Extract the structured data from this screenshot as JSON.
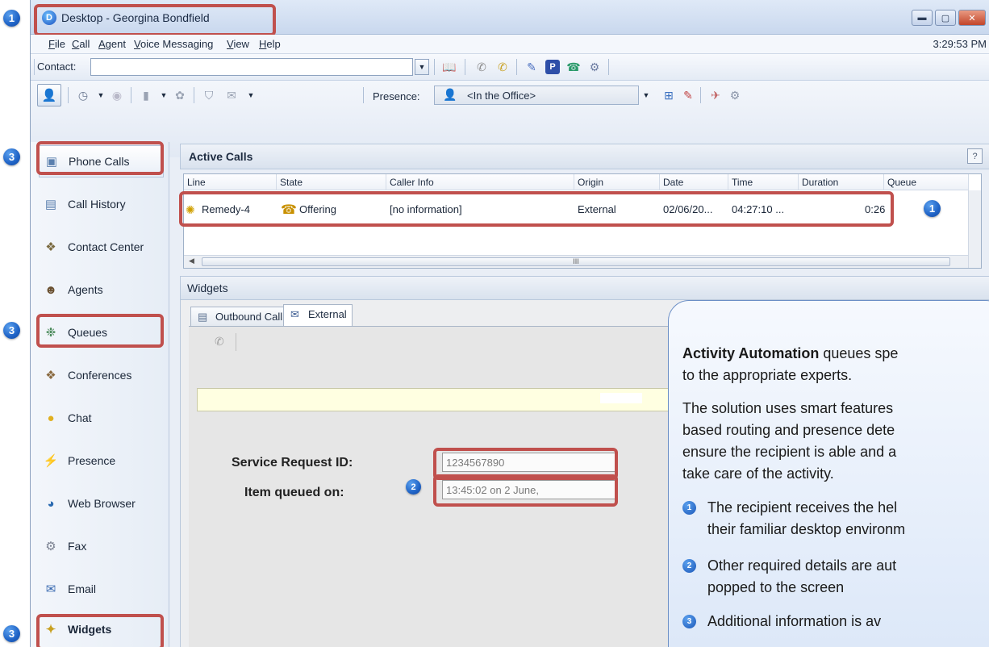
{
  "window": {
    "title": "Desktop - Georgina Bondfield",
    "app_logo": "D",
    "clock": "3:29:53 PM"
  },
  "menu": [
    "File",
    "Call",
    "Agent",
    "Voice Messaging",
    "View",
    "Help"
  ],
  "contact": {
    "label": "Contact:",
    "value": ""
  },
  "presence": {
    "label": "Presence:",
    "value": "<In the Office>"
  },
  "markers": {
    "title": "1",
    "active_call": "1",
    "fields": "2",
    "phone_calls": "3",
    "queues": "3",
    "widgets": "3"
  },
  "sidebar": {
    "items": [
      {
        "label": "Phone Calls",
        "icon": "phone-calls-icon"
      },
      {
        "label": "Call History",
        "icon": "call-history-icon"
      },
      {
        "label": "Contact Center",
        "icon": "contact-center-icon"
      },
      {
        "label": "Agents",
        "icon": "agents-icon"
      },
      {
        "label": "Queues",
        "icon": "queues-icon"
      },
      {
        "label": "Conferences",
        "icon": "conferences-icon"
      },
      {
        "label": "Chat",
        "icon": "chat-icon"
      },
      {
        "label": "Presence",
        "icon": "presence-icon"
      },
      {
        "label": "Web Browser",
        "icon": "web-browser-icon"
      },
      {
        "label": "Fax",
        "icon": "fax-icon"
      },
      {
        "label": "Email",
        "icon": "email-icon"
      },
      {
        "label": "Widgets",
        "icon": "widgets-icon"
      }
    ]
  },
  "active_calls": {
    "title": "Active Calls",
    "help": "?",
    "columns": [
      "Line",
      "State",
      "Caller Info",
      "Origin",
      "Date",
      "Time",
      "Duration",
      "Queue"
    ],
    "rows": [
      {
        "line": "Remedy-4",
        "state": "Offering",
        "caller_info": "[no information]",
        "origin": "External",
        "date": "02/06/20...",
        "time": "04:27:10 ...",
        "duration": "0:26",
        "queue": ""
      }
    ],
    "scroll_marker": "III"
  },
  "widgets": {
    "title": "Widgets",
    "tabs": [
      "Outbound Call",
      "External"
    ],
    "active_tab": "External",
    "form": {
      "service_request_label": "Service Request ID:",
      "service_request_value": "1234567890",
      "queued_on_label": "Item queued on:",
      "queued_on_value": "13:45:02 on 2 June,"
    }
  },
  "callout": {
    "line1_bold": "Activity Automation",
    "line1_rest": " queues spe",
    "line2": "to the appropriate experts.",
    "line3": "The solution uses smart features",
    "line4": "based routing and presence dete",
    "line5": "ensure the recipient is able and a",
    "line6": "take care of the activity.",
    "bullet1_num": "1",
    "bullet1_line1": "The recipient receives the hel",
    "bullet1_line2": "their familiar desktop environm",
    "bullet2_num": "2",
    "bullet2_line1": "Other required details are aut",
    "bullet2_line2": "popped to the screen",
    "bullet3_num": "3",
    "bullet3_line1": "Additional information is av"
  },
  "colors": {
    "highlight": "#c0504d",
    "marker": "#1f63c6",
    "callout_border": "#6c8fc6"
  }
}
